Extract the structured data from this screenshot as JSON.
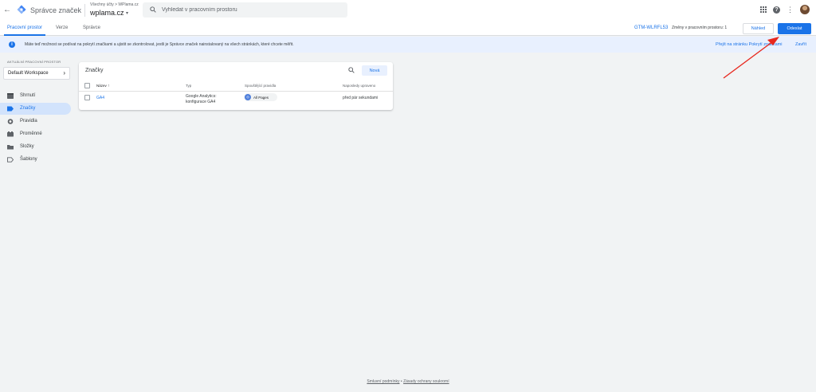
{
  "header": {
    "back_glyph": "←",
    "product_name": "Správce značek",
    "account_crumb": "Všechny účty > WPlama.cz",
    "container_name": "wplama.cz",
    "caret_glyph": "▾",
    "search_placeholder": "Vyhledat v pracovním prostoru",
    "help_glyph": "?",
    "more_glyph": "⋮"
  },
  "tabs": [
    {
      "label": "Pracovní prostor",
      "active": true
    },
    {
      "label": "Verze",
      "active": false
    },
    {
      "label": "Správce",
      "active": false
    }
  ],
  "toolbar": {
    "container_id": "GTM-WLRFL53",
    "changes": "Změny v pracovním prostoru: 1",
    "preview_label": "Náhled",
    "submit_label": "Odeslat"
  },
  "banner": {
    "info_glyph": "i",
    "text": "Máte teď možnost se podívat na pokrytí značkami a ujistit se zkontrolovat, jestli je Správce značek nainstalovaný na všech stránkách, které chcete měřit.",
    "link_coverage": "Přejít na stránku Pokrytí značkami",
    "link_close": "Zavřít"
  },
  "sidebar": {
    "workspace_caption": "AKTUÁLNÍ PRACOVNÍ PROSTOR",
    "workspace_name": "Default Workspace",
    "chevron_glyph": "›",
    "items": [
      {
        "label": "Shrnutí",
        "icon": "summary-icon",
        "active": false
      },
      {
        "label": "Značky",
        "icon": "tag-icon",
        "active": true
      },
      {
        "label": "Pravidla",
        "icon": "trigger-icon",
        "active": false
      },
      {
        "label": "Proměnné",
        "icon": "variable-icon",
        "active": false
      },
      {
        "label": "Složky",
        "icon": "folder-icon",
        "active": false
      },
      {
        "label": "Šablony",
        "icon": "template-icon",
        "active": false
      }
    ]
  },
  "tags_card": {
    "title": "Značky",
    "new_label": "Nová",
    "columns": {
      "name": "Název",
      "sort_glyph": "↑",
      "type": "Typ",
      "triggers": "Spouštějící pravidla",
      "edited": "Naposledy upraveno"
    },
    "rows": [
      {
        "name": "GA4",
        "type_line1": "Google Analytics:",
        "type_line2": "konfigurace GA4",
        "trigger_label": "All Pages",
        "trigger_glyph": "◎",
        "edited": "před pár sekundami"
      }
    ]
  },
  "footer": {
    "terms": "Smluvní podmínky",
    "separator": "•",
    "privacy": "Zásady ochrany soukromí"
  },
  "colors": {
    "accent": "#1a73e8",
    "banner_bg": "#e8f0fe",
    "active_nav_bg": "#d2e3fc",
    "page_bg": "#f1f3f4",
    "annotation": "#e8281e"
  }
}
